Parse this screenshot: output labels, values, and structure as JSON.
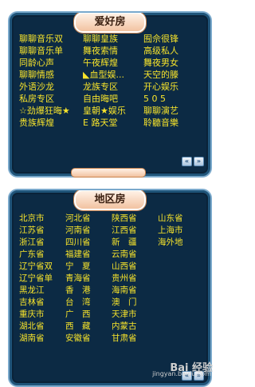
{
  "hobby": {
    "title": "爱好房",
    "rows": [
      [
        "聊聊音乐双",
        "聊聊皇族",
        "囿佘很锋"
      ],
      [
        "聊聊音乐单",
        "舞夜索情",
        "高级私人"
      ],
      [
        "同龄心声",
        "午夜辉煌",
        "舞夜男女"
      ],
      [
        "聊聊情感",
        "◣血型娱...",
        "天空的滕"
      ],
      [
        "外语沙龙",
        "龙族专区",
        "开心娱乐"
      ],
      [
        "私房专区",
        "自由晦吧",
        "5 0 5"
      ],
      [
        "☆劲爆狂晦★",
        "皇朝★娱乐",
        "聊聊演艺"
      ],
      [
        "贵族辉煌",
        "E 路天堂",
        "聆聽音樂"
      ]
    ]
  },
  "region": {
    "title": "地区房",
    "rows": [
      [
        "北京市",
        "河北省",
        "陕西省",
        "山东省"
      ],
      [
        "江苏省",
        "河南省",
        "江西省",
        "上海市"
      ],
      [
        "浙江省",
        "四川省",
        "新　疆",
        "海外地"
      ],
      [
        "广东省",
        "福建省",
        "云南省",
        ""
      ],
      [
        "辽宁省双",
        "宁　夏",
        "山西省",
        ""
      ],
      [
        "辽宁省单",
        "青海省",
        "贵州省",
        ""
      ],
      [
        "黑龙江",
        "香　港",
        "海南省",
        ""
      ],
      [
        "吉林省",
        "台　湾",
        "澳　门",
        ""
      ],
      [
        "重庆市",
        "广　西",
        "天津市",
        ""
      ],
      [
        "湖北省",
        "西　藏",
        "内蒙古",
        ""
      ],
      [
        "湖南省",
        "安徽省",
        "甘肃省",
        ""
      ]
    ]
  },
  "watermark": {
    "brand": "Bai 经验",
    "url": "jingyan.baidu.com"
  },
  "colors": {
    "panel_bg": "#0c2a44",
    "text": "#f6e32b",
    "tab_bg": "#f2c3a1"
  }
}
